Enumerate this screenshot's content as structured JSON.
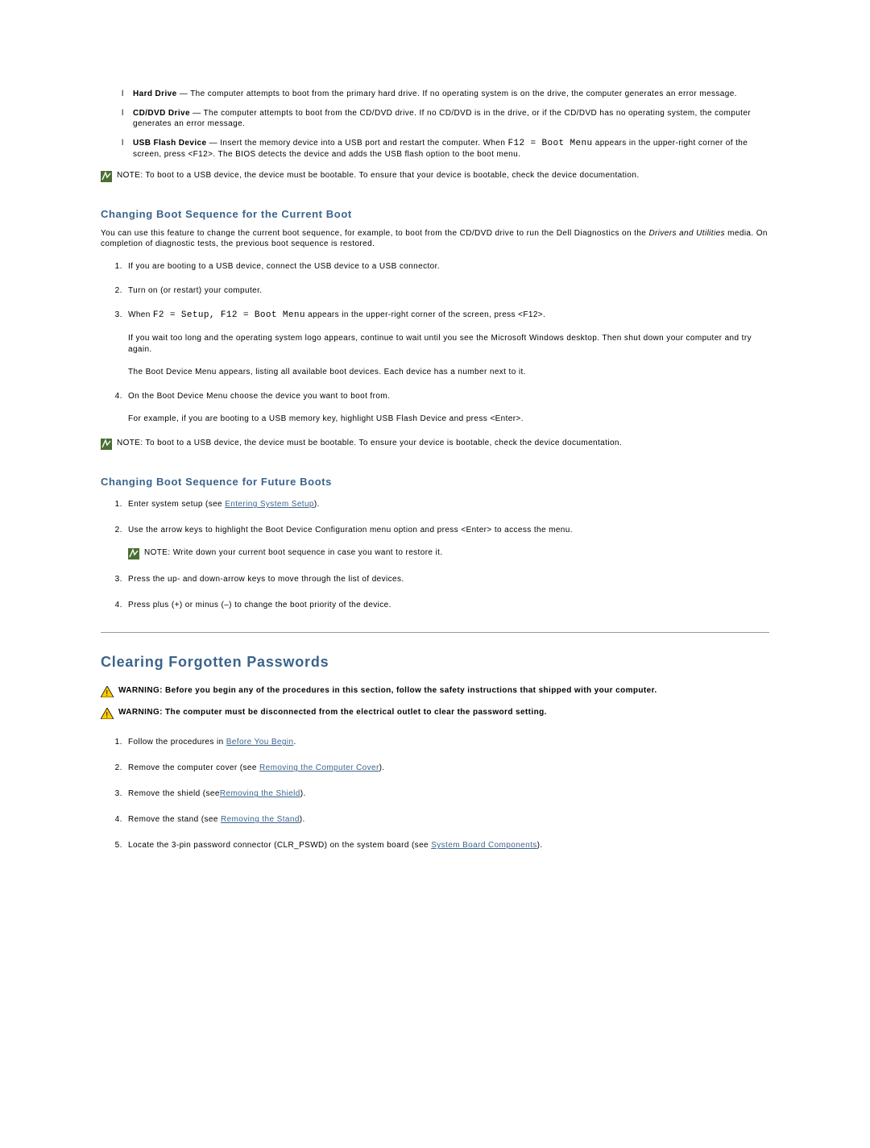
{
  "boot_options": [
    {
      "name": "Hard Drive",
      "desc": "The computer attempts to boot from the primary hard drive. If no operating system is on the drive, the computer generates an error message."
    },
    {
      "name": "CD/DVD Drive",
      "desc": "The computer attempts to boot from the CD/DVD drive. If no CD/DVD is in the drive, or if the CD/DVD has no operating system, the computer generates an error message."
    },
    {
      "name": "USB Flash Device",
      "desc_before_mono": "Insert the memory device into a USB port and restart the computer. When ",
      "mono": "F12 = Boot Menu",
      "desc_after_mono": " appears in the upper-right corner of the screen, press <F12>. The BIOS detects the device and adds the USB flash option to the boot menu."
    }
  ],
  "note1_label": "NOTE:",
  "note1_text": " To boot to a USB device, the device must be bootable. To ensure that your device is bootable, check the device documentation.",
  "sub1": "Changing Boot Sequence for the Current Boot",
  "intro1_a": "You can use this feature to change the current boot sequence, for example, to boot from the CD/DVD drive to run the Dell Diagnostics on the ",
  "intro1_italic": "Drivers and Utilities",
  "intro1_b": " media. On completion of diagnostic tests, the previous boot sequence is restored.",
  "steps_current": {
    "s1": "If you are booting to a USB device, connect the USB device to a USB connector.",
    "s2": "Turn on (or restart) your computer.",
    "s3_pre": "When ",
    "s3_mono": "F2 = Setup, F12 = Boot Menu",
    "s3_post": " appears in the upper-right corner of the screen, press <F12>.",
    "s3_p2": "If you wait too long and the operating system logo appears, continue to wait until you see the Microsoft Windows desktop. Then shut down your computer and try again.",
    "s3_p3": "The Boot Device Menu appears, listing all available boot devices. Each device has a number next to it.",
    "s4": "On the Boot Device Menu choose the device you want to boot from.",
    "s4_p2": "For example, if you are booting to a USB memory key, highlight USB Flash Device and press <Enter>."
  },
  "note2_label": "NOTE:",
  "note2_text": " To boot to a USB device, the device must be bootable. To ensure your device is bootable, check the device documentation.",
  "sub2": "Changing Boot Sequence for Future Boots",
  "steps_future": {
    "s1_pre": "Enter system setup (see ",
    "s1_link": "Entering System Setup",
    "s1_post": ").",
    "s2": "Use the arrow keys to highlight the Boot Device Configuration menu option and press <Enter> to access the menu.",
    "s2_note_label": "NOTE:",
    "s2_note_text": " Write down your current boot sequence in case you want to restore it.",
    "s3": "Press the up- and down-arrow keys to move through the list of devices.",
    "s4": "Press plus (+) or minus (–) to change the boot priority of the device."
  },
  "section2": "Clearing Forgotten Passwords",
  "warn1_label": "WARNING:",
  "warn1_text": " Before you begin any of the procedures in this section, follow the safety instructions that shipped with your computer.",
  "warn2_label": "WARNING:",
  "warn2_text": " The computer must be disconnected from the electrical outlet to clear the password setting.",
  "clear_steps": {
    "s1_pre": "Follow the procedures in ",
    "s1_link": "Before You Begin",
    "s1_post": ".",
    "s2_pre": "Remove the computer cover (see ",
    "s2_link": "Removing the Computer Cover",
    "s2_post": ").",
    "s3_pre": "Remove the shield (see",
    "s3_link": "Removing the Shield",
    "s3_post": ").",
    "s4_pre": "Remove the stand (see ",
    "s4_link": "Removing the Stand",
    "s4_post": ").",
    "s5_pre": "Locate the 3-pin password connector (CLR_PSWD) on the system board (see ",
    "s5_link": "System Board Components",
    "s5_post": ")."
  }
}
